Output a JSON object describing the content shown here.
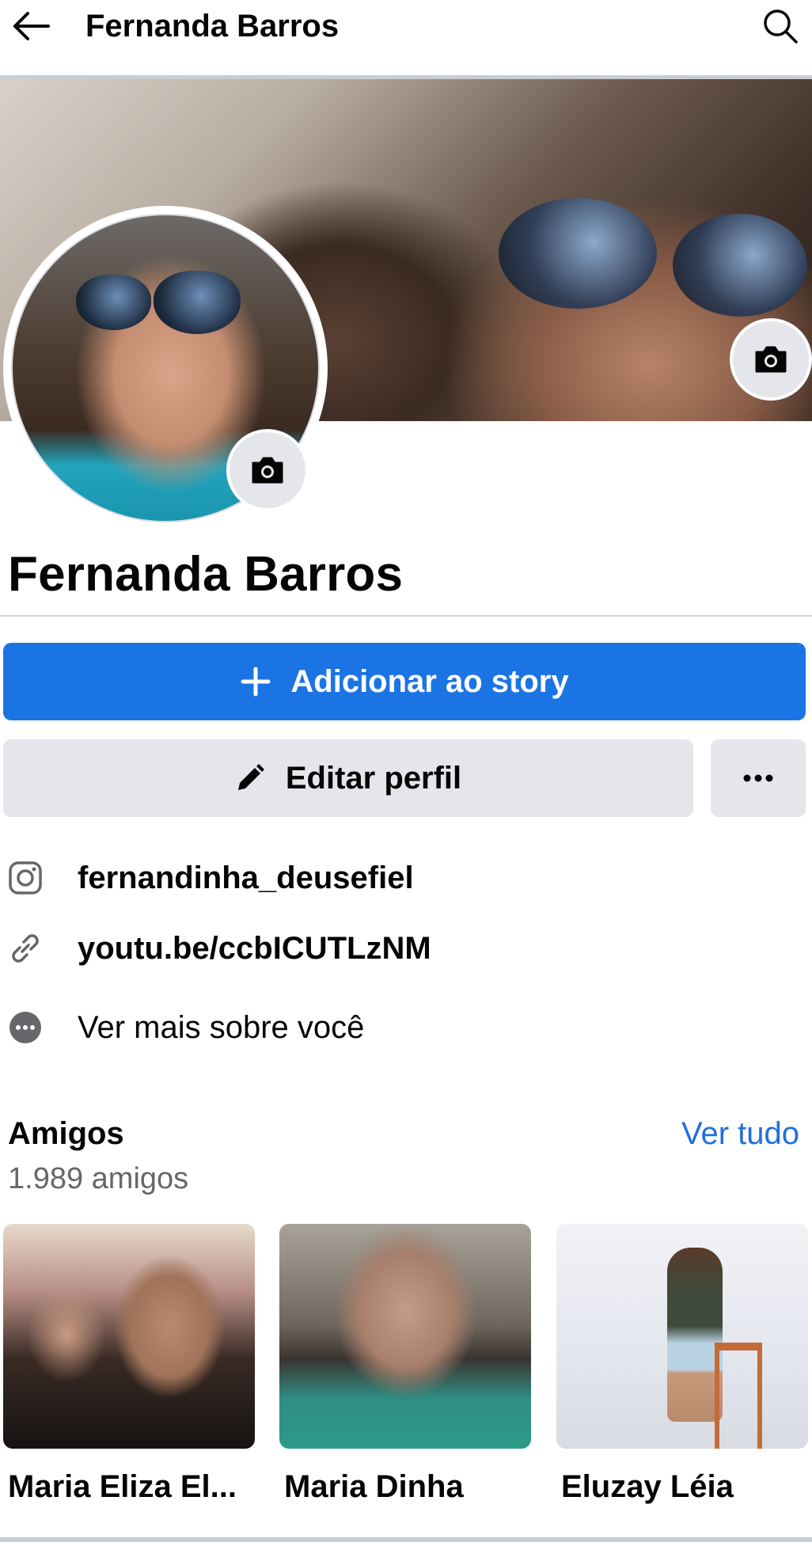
{
  "topbar": {
    "title": "Fernanda Barros",
    "back_icon": "arrow-left-icon",
    "search_icon": "search-icon"
  },
  "profile": {
    "name": "Fernanda Barros",
    "cover_camera_icon": "camera-icon",
    "avatar_camera_icon": "camera-icon"
  },
  "actions": {
    "story_label": "Adicionar ao story",
    "edit_label": "Editar perfil",
    "more_icon": "more-dots-icon"
  },
  "info": {
    "instagram": "fernandinha_deusefiel",
    "link": "youtu.be/ccbICUTLzNM",
    "see_more": "Ver mais sobre você"
  },
  "friends": {
    "title": "Amigos",
    "count": "1.989 amigos",
    "see_all": "Ver tudo",
    "items": [
      {
        "name": "Maria Eliza El..."
      },
      {
        "name": "Maria Dinha"
      },
      {
        "name": "Eluzay Léia"
      }
    ]
  },
  "colors": {
    "primary": "#1b74e4",
    "link": "#216fdb",
    "button_gray": "#e4e6eb",
    "secondary_text": "#65676b"
  }
}
